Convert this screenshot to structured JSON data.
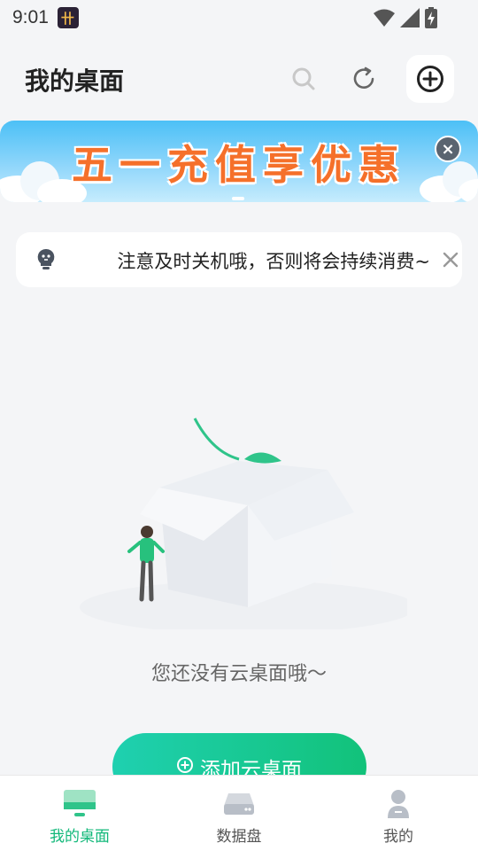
{
  "status_bar": {
    "time": "9:01"
  },
  "header": {
    "title": "我的桌面"
  },
  "banner": {
    "text": "五一充值享优惠"
  },
  "notice": {
    "text": "注意及时关机哦，否则将会持续消费~"
  },
  "empty_state": {
    "message": "您还没有云桌面哦～",
    "button_label": "添加云桌面"
  },
  "bottom_nav": {
    "items": [
      {
        "label": "我的桌面",
        "active": true
      },
      {
        "label": "数据盘",
        "active": false
      },
      {
        "label": "我的",
        "active": false
      }
    ]
  },
  "colors": {
    "accent": "#12b87a",
    "banner_text": "#f5702a",
    "banner_bg": "#4cc0f6"
  }
}
